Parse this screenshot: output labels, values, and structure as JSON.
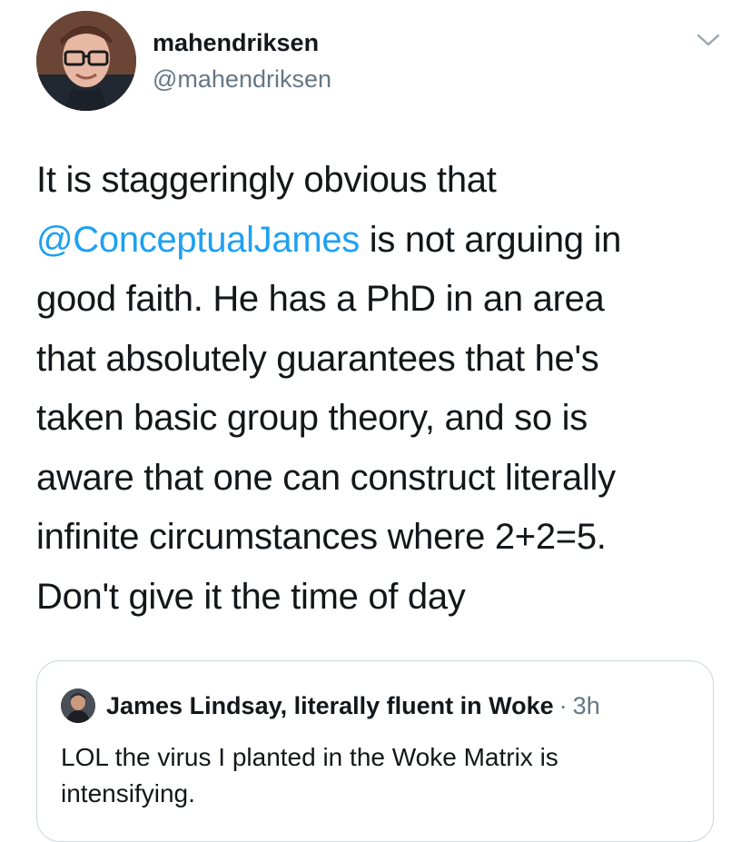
{
  "author": {
    "display_name": "mahendriksen",
    "handle": "@mahendriksen",
    "avatar": "user-avatar-photo"
  },
  "menu": {
    "icon": "chevron-down-icon"
  },
  "tweet": {
    "lines": [
      {
        "text": "It is staggeringly obvious that"
      },
      {
        "mention": "@ConceptualJames",
        "text": " is not arguing in"
      },
      {
        "text": "good faith. He has a PhD in an area"
      },
      {
        "text": "that absolutely guarantees that he's"
      },
      {
        "text": "taken basic group theory, and so is"
      },
      {
        "text": "aware that one can construct literally"
      },
      {
        "text": "infinite circumstances where 2+2=5."
      },
      {
        "text": "Don't give it the time of day"
      }
    ]
  },
  "quoted_tweet": {
    "display_name": "James Lindsay, literally fluent in Woke",
    "separator": "·",
    "time": "3h",
    "lines": [
      "LOL the virus I planted in the Woke Matrix is",
      "intensifying."
    ]
  },
  "colors": {
    "text": "#14171a",
    "secondary": "#657786",
    "link": "#1da1f2",
    "border": "#ccd6dd"
  }
}
